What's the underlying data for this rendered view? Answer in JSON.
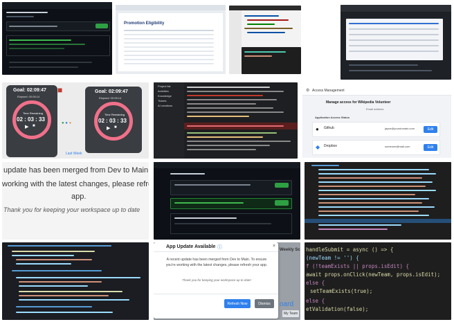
{
  "timer": {
    "goal": "Goal: 02:09:47",
    "elapsed": "Elapsed: 00:06:14",
    "time_label": "Time Remaining",
    "time": "02 : 03 : 33"
  },
  "sidebar_menu": {
    "items": [
      "Project list",
      "Activities",
      "Knowledge",
      "Tickets",
      "AI creations"
    ]
  },
  "access_panel": {
    "title": "Access Management",
    "heading": "Manage access for Wikipedia Volunteer",
    "subheading": "Email address",
    "section": "Application Access Status",
    "rows": [
      {
        "name": "Github",
        "email": "jayce@yourdomain.com",
        "button": "Edit"
      },
      {
        "name": "Dropbox",
        "email": "someone@mail.com",
        "button": "Edit"
      }
    ]
  },
  "banner": {
    "line1": "update has been merged from Dev to Main.",
    "line2": "working with the latest changes, please refre",
    "line3": "app.",
    "thanks": "Thank you for keeping your workspace up to date"
  },
  "dialog": {
    "title": "App Update Available",
    "body": "A recent update has been merged from Dev to Main. To ensure you're working with the latest changes, please refresh your app.",
    "note": "Thank you for keeping your workspace up to date!",
    "refresh": "Refresh Now",
    "dismiss": "Dismiss",
    "side_header": "Weekly Sc",
    "side_board": "oard",
    "side_team": "My Team"
  },
  "code_snippet": {
    "lines": [
      "handleSubmit = async () => {",
      "(newTeam != '') {",
      "f (!teamExists || props.isEdit) {",
      "await props.onClick(newTeam, props.isEdit);",
      "else {",
      "setTeamExists(true);",
      "else {",
      "etValidation(false);"
    ]
  },
  "promotion": {
    "title": "Promotion Eligibility"
  },
  "colors": {
    "dark_bg": "#1e1f22",
    "accent_green": "#2ea043",
    "timer_ring": "#f0708a",
    "link_blue": "#2f80ed"
  }
}
